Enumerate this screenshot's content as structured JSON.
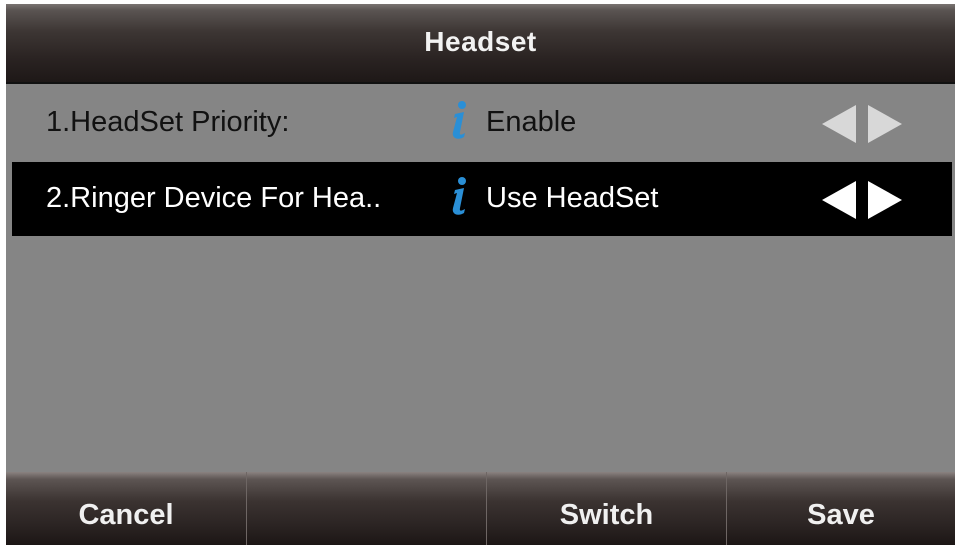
{
  "header": {
    "title": "Headset"
  },
  "settings": [
    {
      "label": "1.HeadSet Priority:",
      "value": "Enable",
      "info_icon": "info-icon",
      "selected": false
    },
    {
      "label": "2.Ringer Device For Hea..",
      "value": "Use HeadSet",
      "info_icon": "info-icon",
      "selected": true
    }
  ],
  "softkeys": {
    "k1": "Cancel",
    "k2": "",
    "k3": "Switch",
    "k4": "Save"
  },
  "colors": {
    "screen_bg": "#858585",
    "selected_row_bg": "#000000",
    "info_icon": "#2a8fd6",
    "arrow_inactive": "#d8d8d8",
    "arrow_active": "#ffffff"
  }
}
